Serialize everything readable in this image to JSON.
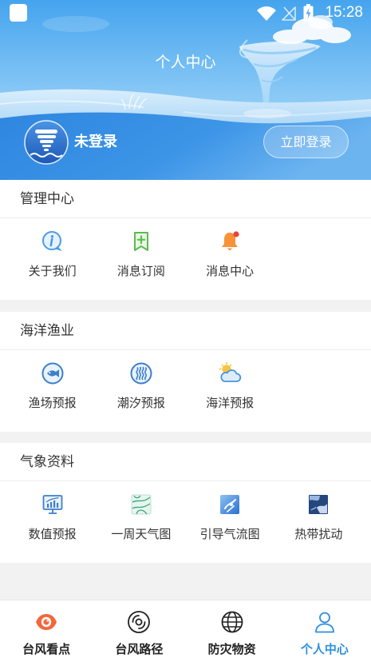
{
  "status_bar": {
    "time": "15:28",
    "icons": [
      "notification-square-icon",
      "wifi-icon",
      "no-sim-signal-icon",
      "battery-charging-icon"
    ]
  },
  "header": {
    "title": "个人中心",
    "username": "未登录",
    "login_button": "立即登录"
  },
  "sections": [
    {
      "title": "管理中心",
      "items": [
        {
          "label": "关于我们",
          "icon": "info-bubble-icon"
        },
        {
          "label": "消息订阅",
          "icon": "bookmark-plus-icon"
        },
        {
          "label": "消息中心",
          "icon": "bell-icon"
        }
      ]
    },
    {
      "title": "海洋渔业",
      "items": [
        {
          "label": "渔场预报",
          "icon": "fish-icon"
        },
        {
          "label": "潮汐预报",
          "icon": "tide-icon"
        },
        {
          "label": "海洋预报",
          "icon": "sun-cloud-icon"
        }
      ]
    },
    {
      "title": "气象资料",
      "items": [
        {
          "label": "数值预报",
          "icon": "monitor-chart-icon"
        },
        {
          "label": "一周天气图",
          "icon": "weather-map-icon"
        },
        {
          "label": "引导气流图",
          "icon": "airflow-map-icon"
        },
        {
          "label": "热带扰动",
          "icon": "tropical-disturbance-icon"
        }
      ]
    }
  ],
  "bottom_nav": [
    {
      "label": "台风看点",
      "icon": "eye-icon",
      "active": false
    },
    {
      "label": "台风路径",
      "icon": "typhoon-icon",
      "active": false
    },
    {
      "label": "防灾物资",
      "icon": "globe-icon",
      "active": false
    },
    {
      "label": "个人中心",
      "icon": "person-icon",
      "active": true
    }
  ],
  "colors": {
    "accent": "#2f8fe0",
    "page_background": "#f2f2f2",
    "text": "#333333",
    "hero_sky": "#45a4ee",
    "hero_sea": "#2e86e0"
  }
}
